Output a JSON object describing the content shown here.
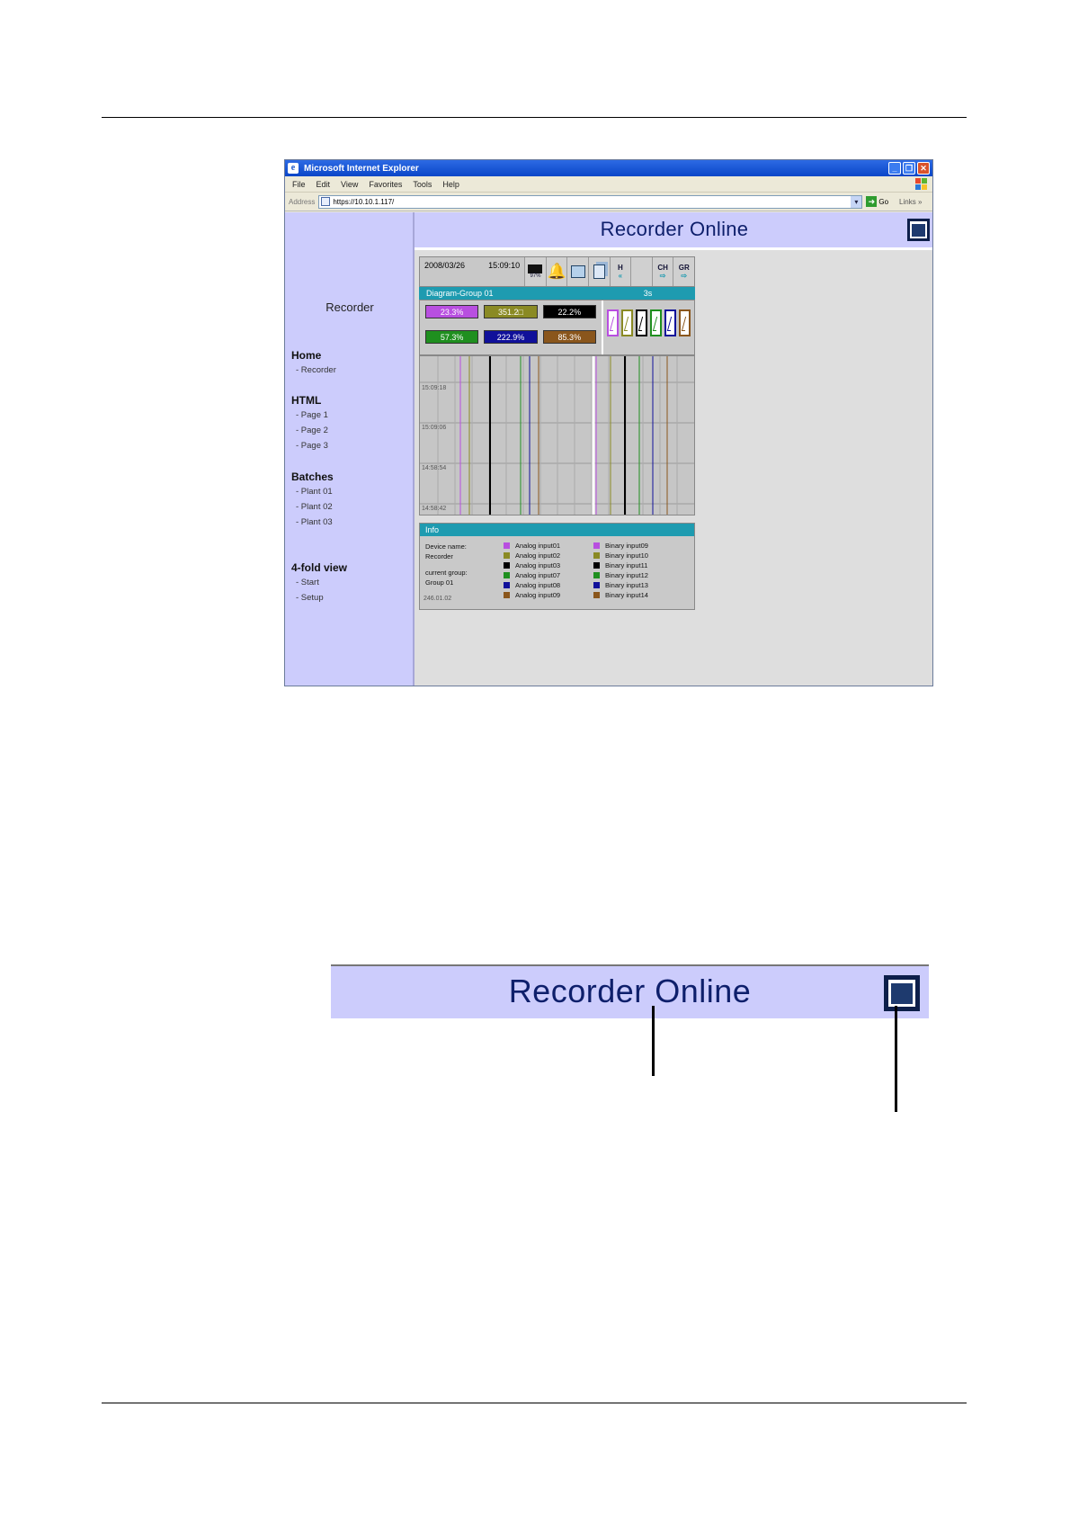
{
  "window": {
    "title": "Microsoft Internet Explorer",
    "menu": [
      "File",
      "Edit",
      "View",
      "Favorites",
      "Tools",
      "Help"
    ],
    "address_label": "Address",
    "address_value": "https://10.10.1.117/",
    "go_label": "Go",
    "links_label": "Links"
  },
  "sidebar": {
    "title": "Recorder",
    "sections": [
      {
        "heading": "Home",
        "items": [
          "- Recorder"
        ]
      },
      {
        "heading": "HTML",
        "items": [
          "- Page 1",
          "- Page 2",
          "- Page 3"
        ]
      },
      {
        "heading": "Batches",
        "items": [
          "- Plant 01",
          "- Plant 02",
          "- Plant 03"
        ]
      },
      {
        "heading": "4-fold view",
        "items": [
          "- Start",
          "- Setup"
        ]
      }
    ]
  },
  "header": {
    "title": "Recorder Online"
  },
  "recorder": {
    "date": "2008/03/26",
    "time": "15:09:10",
    "memory_percent": "97%",
    "buttons": {
      "history": "H",
      "channel": "CH",
      "group": "GR"
    },
    "group_name": "Diagram-Group 01",
    "interval": "3s",
    "values": [
      {
        "text": "23.3%",
        "color": "#b84fe0"
      },
      {
        "text": "351.2□",
        "color": "#8a8a24"
      },
      {
        "text": "22.2%",
        "color": "#000000"
      },
      {
        "text": "57.3%",
        "color": "#1f8f1f"
      },
      {
        "text": "222.9%",
        "color": "#10109a"
      },
      {
        "text": "85.3%",
        "color": "#8a561c"
      }
    ],
    "binary_colors": [
      "#b84fe0",
      "#8a8a24",
      "#000000",
      "#1f8f1f",
      "#10109a",
      "#8a561c"
    ],
    "time_labels": [
      "15:09:18",
      "15:09:06",
      "14:58:54",
      "14:58:42"
    ]
  },
  "info": {
    "heading": "Info",
    "device_label": "Device name:",
    "device_value": "Recorder",
    "group_label": "current group:",
    "group_value": "Group 01",
    "analog": [
      "Analog input01",
      "Analog input02",
      "Analog input03",
      "Analog input07",
      "Analog input08",
      "Analog input09"
    ],
    "binary": [
      "Binary input09",
      "Binary input10",
      "Binary input11",
      "Binary input12",
      "Binary input13",
      "Binary input14"
    ],
    "legend_colors": [
      "#b84fe0",
      "#8a8a24",
      "#000000",
      "#1f8f1f",
      "#10109a",
      "#8a561c"
    ]
  },
  "version": "246.01.02",
  "zoom": {
    "title": "Recorder Online"
  }
}
